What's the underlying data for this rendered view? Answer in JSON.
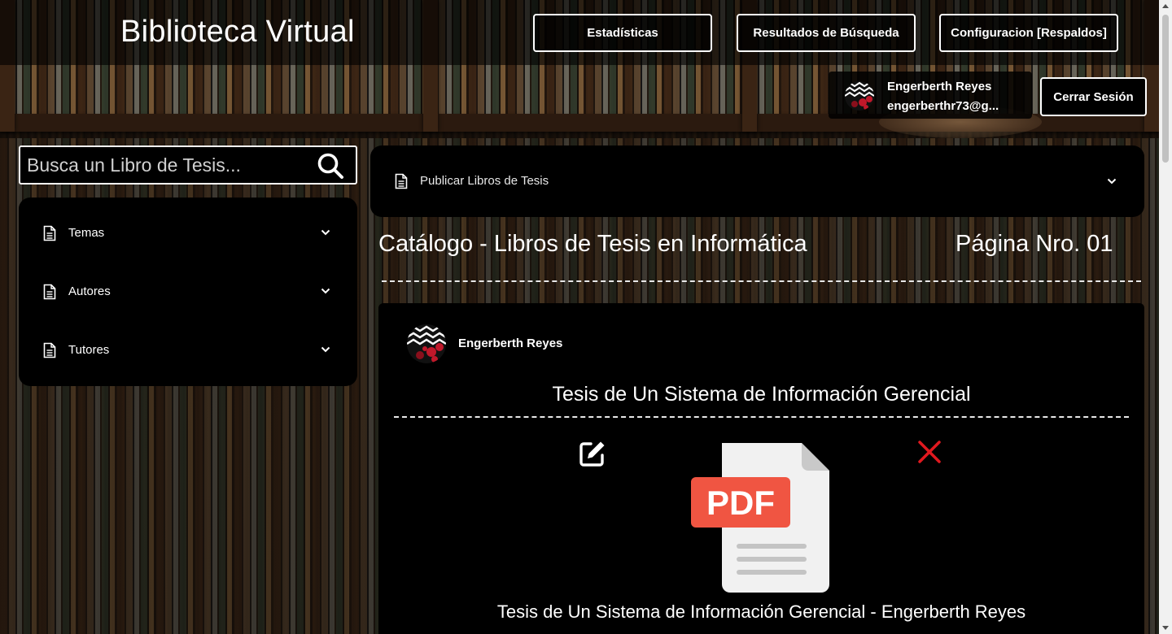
{
  "header": {
    "site_title": "Biblioteca Virtual",
    "nav": [
      {
        "label": "Estadísticas"
      },
      {
        "label": "Resultados de Búsqueda"
      },
      {
        "label": "Configuracion [Respaldos]"
      }
    ],
    "user": {
      "name": "Engerberth Reyes",
      "email": "engerberthr73@g..."
    },
    "logout_label": "Cerrar Sesión"
  },
  "search": {
    "placeholder": "Busca un Libro de Tesis...",
    "value": "",
    "icon": "search-icon"
  },
  "sidebar": {
    "items": [
      {
        "label": "Temas",
        "icon": "document-icon"
      },
      {
        "label": "Autores",
        "icon": "document-icon"
      },
      {
        "label": "Tutores",
        "icon": "document-icon"
      }
    ]
  },
  "publish": {
    "label": "Publicar Libros de Tesis",
    "icon": "document-icon"
  },
  "catalog": {
    "title": "Catálogo - Libros de Tesis en Informática",
    "page": "Página Nro. 01"
  },
  "card": {
    "author": "Engerberth Reyes",
    "title": "Tesis de Un Sistema de Información Gerencial",
    "file_label": "PDF",
    "caption": "Tesis de Un Sistema de Información Gerencial - Engerberth Reyes",
    "delete_color": "#e0191f",
    "pdf_badge_color": "#f05542"
  }
}
